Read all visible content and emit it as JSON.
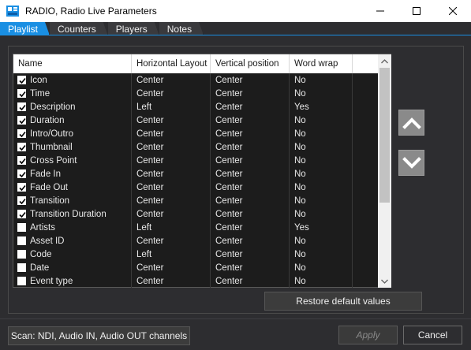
{
  "window": {
    "title": "RADIO, Radio Live Parameters"
  },
  "tabs": [
    {
      "label": "Playlist",
      "active": true
    },
    {
      "label": "Counters",
      "active": false
    },
    {
      "label": "Players",
      "active": false
    },
    {
      "label": "Notes",
      "active": false
    }
  ],
  "table": {
    "headers": {
      "name": "Name",
      "horizontal": "Horizontal Layout",
      "vertical": "Vertical position",
      "wrap": "Word wrap"
    },
    "rows": [
      {
        "checked": true,
        "name": "Icon",
        "horizontal": "Center",
        "vertical": "Center",
        "wrap": "No"
      },
      {
        "checked": true,
        "name": "Time",
        "horizontal": "Center",
        "vertical": "Center",
        "wrap": "No"
      },
      {
        "checked": true,
        "name": "Description",
        "horizontal": "Left",
        "vertical": "Center",
        "wrap": "Yes"
      },
      {
        "checked": true,
        "name": "Duration",
        "horizontal": "Center",
        "vertical": "Center",
        "wrap": "No"
      },
      {
        "checked": true,
        "name": "Intro/Outro",
        "horizontal": "Center",
        "vertical": "Center",
        "wrap": "No"
      },
      {
        "checked": true,
        "name": "Thumbnail",
        "horizontal": "Center",
        "vertical": "Center",
        "wrap": "No"
      },
      {
        "checked": true,
        "name": "Cross Point",
        "horizontal": "Center",
        "vertical": "Center",
        "wrap": "No"
      },
      {
        "checked": true,
        "name": "Fade In",
        "horizontal": "Center",
        "vertical": "Center",
        "wrap": "No"
      },
      {
        "checked": true,
        "name": "Fade Out",
        "horizontal": "Center",
        "vertical": "Center",
        "wrap": "No"
      },
      {
        "checked": true,
        "name": "Transition",
        "horizontal": "Center",
        "vertical": "Center",
        "wrap": "No"
      },
      {
        "checked": true,
        "name": "Transition Duration",
        "horizontal": "Center",
        "vertical": "Center",
        "wrap": "No"
      },
      {
        "checked": false,
        "name": "Artists",
        "horizontal": "Left",
        "vertical": "Center",
        "wrap": "Yes"
      },
      {
        "checked": false,
        "name": "Asset ID",
        "horizontal": "Center",
        "vertical": "Center",
        "wrap": "No"
      },
      {
        "checked": false,
        "name": "Code",
        "horizontal": "Left",
        "vertical": "Center",
        "wrap": "No"
      },
      {
        "checked": false,
        "name": "Date",
        "horizontal": "Center",
        "vertical": "Center",
        "wrap": "No"
      },
      {
        "checked": false,
        "name": "Event type",
        "horizontal": "Center",
        "vertical": "Center",
        "wrap": "No"
      }
    ]
  },
  "buttons": {
    "move_up_icon": "chevron-up-icon",
    "move_down_icon": "chevron-down-icon",
    "restore": "Restore default values",
    "scan": "Scan: NDI, Audio IN, Audio OUT channels",
    "apply": "Apply",
    "cancel": "Cancel"
  },
  "colors": {
    "accent": "#1a8fe3",
    "background": "#2d2d30",
    "table_bg": "#1c1c1c"
  }
}
